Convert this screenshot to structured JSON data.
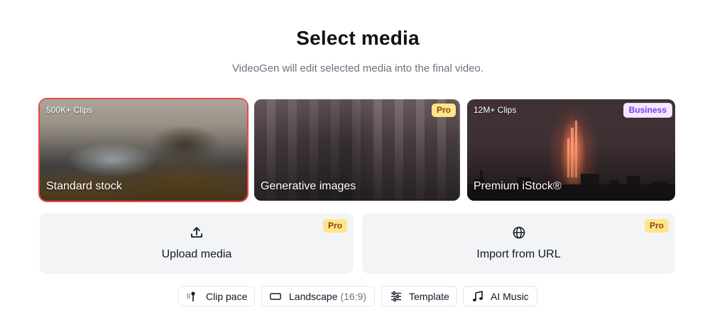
{
  "header": {
    "title": "Select media",
    "subtitle": "VideoGen will edit selected media into the final video."
  },
  "media_cards": [
    {
      "tag": "500K+ Clips",
      "label": "Standard stock",
      "badge": "",
      "selected": true
    },
    {
      "tag": "",
      "label": "Generative images",
      "badge": "Pro",
      "selected": false
    },
    {
      "tag": "12M+ Clips",
      "label": "Premium iStock®",
      "badge": "Business",
      "selected": false
    }
  ],
  "actions": [
    {
      "label": "Upload media",
      "badge": "Pro",
      "icon": "upload-icon"
    },
    {
      "label": "Import from URL",
      "badge": "Pro",
      "icon": "globe-icon"
    }
  ],
  "options": {
    "clip_pace": "Clip pace",
    "orientation": "Landscape",
    "orientation_ratio": "(16:9)",
    "template": "Template",
    "music": "AI Music"
  },
  "colors": {
    "selected_border": "#ef4444",
    "pro_badge_bg": "#fde68a",
    "business_badge_text": "#7c3aed"
  }
}
